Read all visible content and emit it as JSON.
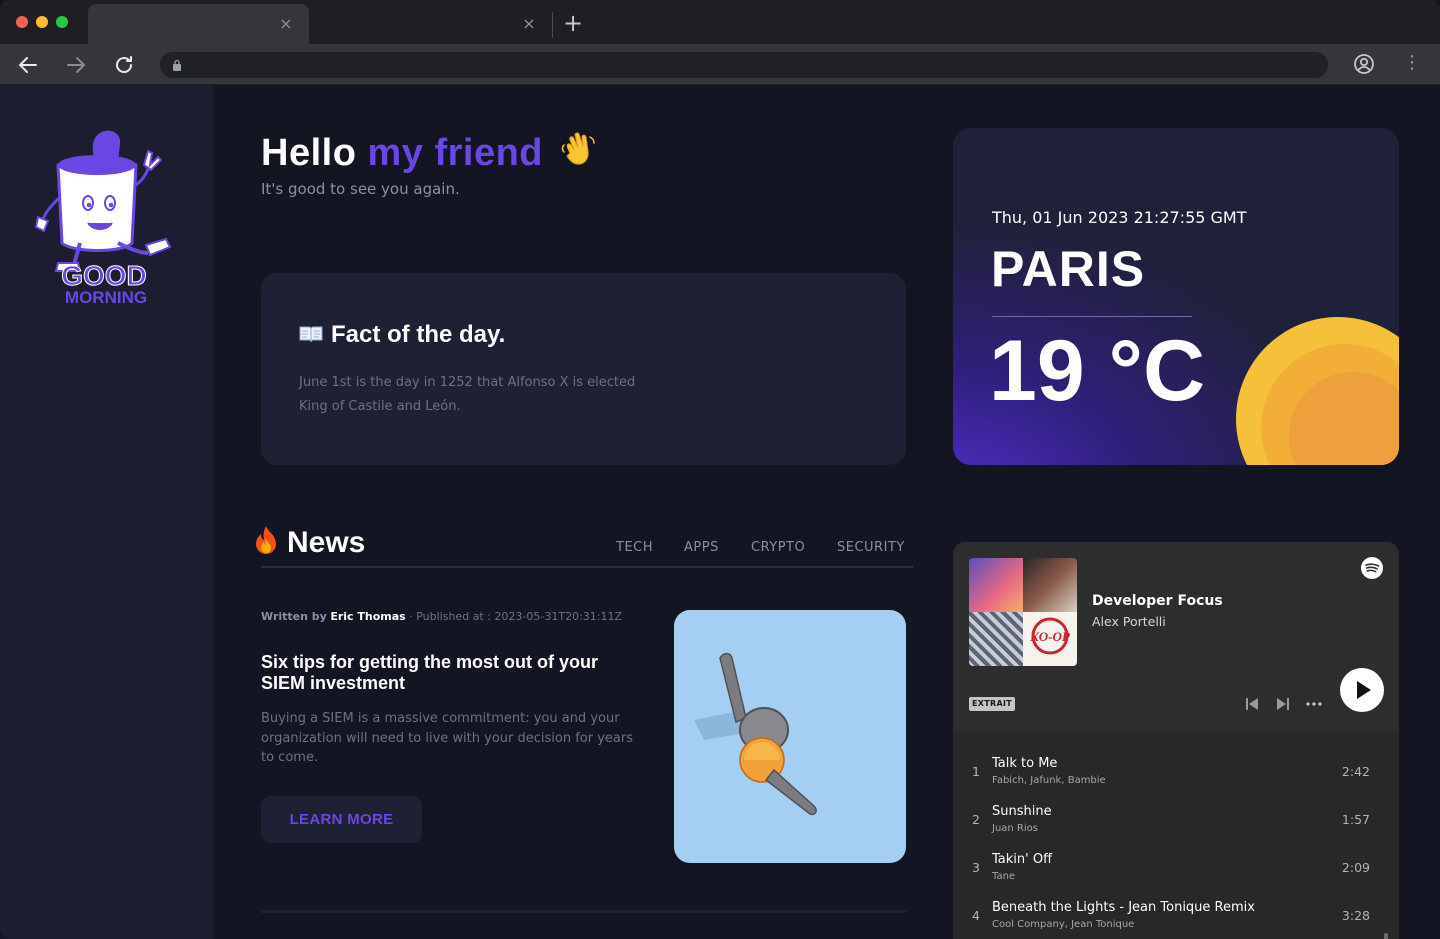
{
  "browser": {
    "tabs": [
      {
        "title": ""
      },
      {
        "title": ""
      }
    ],
    "tab_close_glyph": "×",
    "new_tab_glyph": "+",
    "url": "",
    "menu_glyph": "⋮"
  },
  "sidebar": {
    "logo_text_top": "GOOD",
    "logo_text_bottom": "MORNING"
  },
  "greeting": {
    "hello": "Hello ",
    "highlight": "my friend",
    "emoji": "👋",
    "subtitle": "It's good to see you again."
  },
  "fact": {
    "title": "Fact of the day.",
    "text": "June 1st is the day in 1252 that Alfonso X is elected King of Castile and León."
  },
  "weather": {
    "datetime": "Thu, 01 Jun 2023 21:27:55 GMT",
    "city": "PARIS",
    "temperature": "19 °C"
  },
  "news": {
    "title": "News",
    "categories": [
      "TECH",
      "APPS",
      "CRYPTO",
      "SECURITY"
    ],
    "article": {
      "written_by_label": "Written by",
      "author": "Eric Thomas",
      "published_label": "· Published at : 2023-05-31T20:31:11Z",
      "title": "Six tips for getting the most out of your SIEM investment",
      "summary": "Buying a SIEM is a massive commitment: you and your organization will need to live with your decision for years to come.",
      "button": "LEARN MORE"
    }
  },
  "spotify": {
    "playlist_name": "Developer Focus",
    "owner": "Alex Portelli",
    "badge": "EXTRAIT",
    "tracks": [
      {
        "num": "1",
        "title": "Talk to Me",
        "artists": "Fabich, Jafunk, Bambie",
        "duration": "2:42"
      },
      {
        "num": "2",
        "title": "Sunshine",
        "artists": "Juan Rios",
        "duration": "1:57"
      },
      {
        "num": "3",
        "title": "Takin' Off",
        "artists": "Tane",
        "duration": "2:09"
      },
      {
        "num": "4",
        "title": "Beneath the Lights - Jean Tonique Remix",
        "artists": "Cool Company, Jean Tonique",
        "duration": "3:28"
      }
    ]
  },
  "colors": {
    "accent": "#6a46e2",
    "background": "#141523",
    "card": "#1e2034",
    "sidebar": "#1c1d30",
    "sun_outer": "#f5c13a",
    "sun_inner": "#f0a43a"
  }
}
